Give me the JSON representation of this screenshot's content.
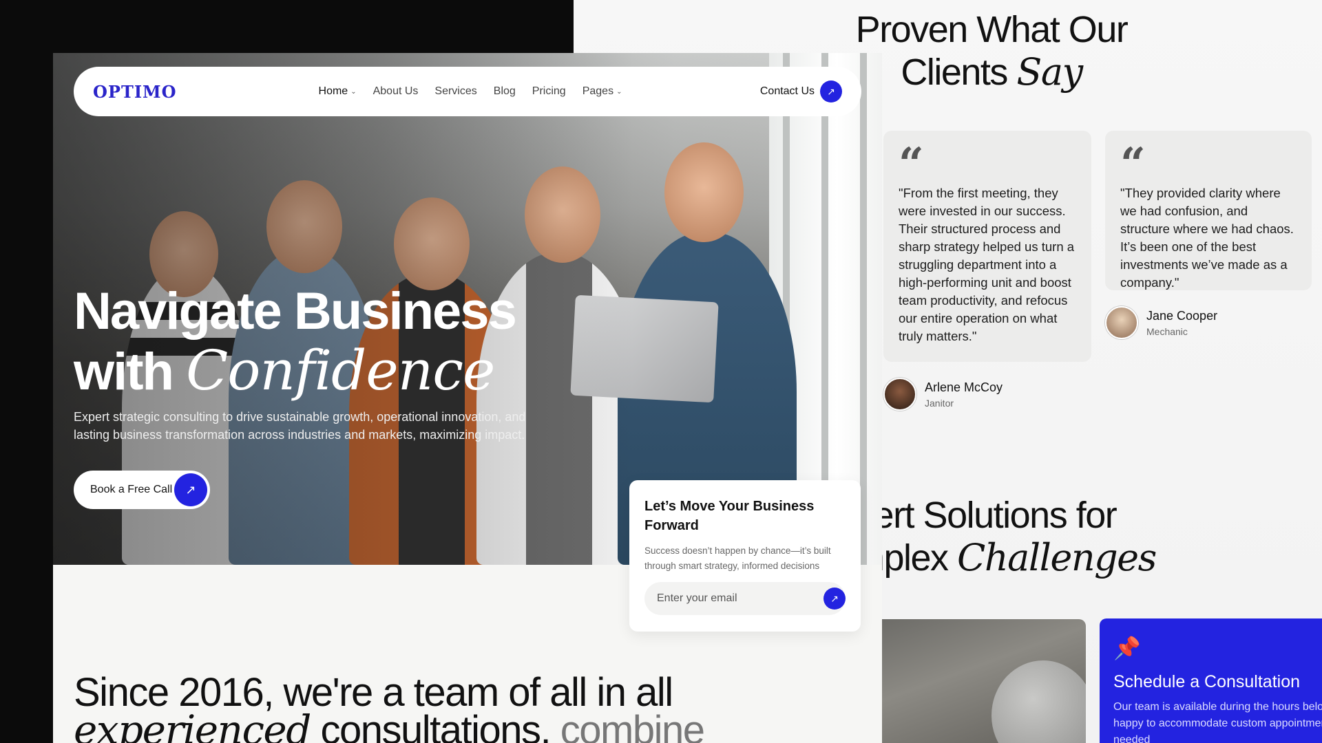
{
  "testimonials": {
    "title_line1": "Proven What Our",
    "title_line2_plain": "Clients ",
    "title_line2_italic": "Say",
    "cards": [
      {
        "text": "\"From the first meeting, they were invested in our success. Their structured process and sharp strategy helped us turn a struggling department into a high-performing unit and boost team productivity, and refocus our entire operation on what truly matters.\"",
        "author_name": "Arlene McCoy",
        "author_role": "Janitor"
      },
      {
        "text": "\"They provided clarity where we had confusion, and structure where we had chaos. It’s been one of the best investments we’ve made as a company.\"",
        "author_name": "Jane Cooper",
        "author_role": "Mechanic"
      }
    ]
  },
  "solutions": {
    "title_line1": "pert Solutions for",
    "title_line2_plain": "mplex ",
    "title_line2_italic": "Challenges"
  },
  "consultation": {
    "title": "Schedule a Consultation",
    "text_line1": "Our team is available during the hours below",
    "text_line2": "happy to accommodate custom appointmen",
    "text_line3": "needed"
  },
  "nav": {
    "logo": "OPTIMO",
    "items": [
      "Home",
      "About Us",
      "Services",
      "Blog",
      "Pricing",
      "Pages"
    ],
    "contact": "Contact Us"
  },
  "hero": {
    "title_line1": "Navigate Business",
    "title_line2_plain": "with ",
    "title_line2_italic": "Confidence",
    "subtitle": "Expert strategic consulting to drive sustainable growth, operational innovation, and lasting business transformation across industries and markets, maximizing impact.",
    "cta": "Book a Free Call"
  },
  "subscribe": {
    "title": "Let’s Move Your Business Forward",
    "text": "Success doesn’t happen by chance—it’s built through smart strategy, informed decisions",
    "placeholder": "Enter your email"
  },
  "about": {
    "line1": "Since 2016, we're a team of all in all",
    "line2_italic": "experienced",
    "line2_plain": " consultations,",
    "line2_muted": " combine"
  },
  "colors": {
    "accent": "#2323e0",
    "logo": "#2a24c9"
  }
}
